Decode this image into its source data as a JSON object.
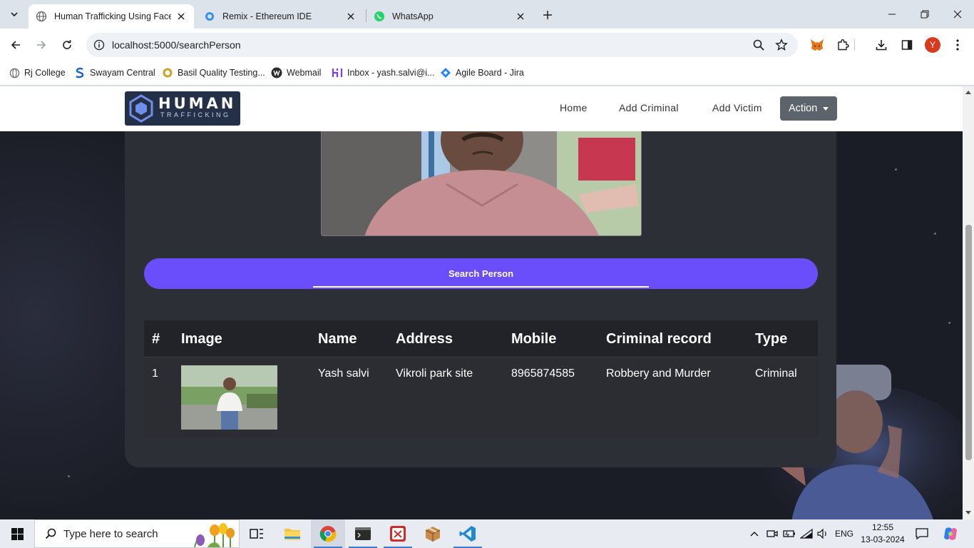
{
  "browser": {
    "tabs": [
      {
        "title": "Human Trafficking Using Face R",
        "active": true,
        "icon": "globe-icon"
      },
      {
        "title": "Remix - Ethereum IDE",
        "active": false,
        "icon": "remix-icon"
      },
      {
        "title": "WhatsApp",
        "active": false,
        "icon": "whatsapp-icon"
      }
    ],
    "url": "localhost:5000/searchPerson",
    "bookmarks": [
      {
        "label": "Rj College",
        "icon": "globe-icon"
      },
      {
        "label": "Swayam Central",
        "icon": "swayam-icon"
      },
      {
        "label": "Basil Quality Testing...",
        "icon": "basil-icon"
      },
      {
        "label": "Webmail",
        "icon": "webmail-icon"
      },
      {
        "label": "Inbox - yash.salvi@i...",
        "icon": "inbox-icon"
      },
      {
        "label": "Agile Board - Jira",
        "icon": "jira-icon"
      }
    ],
    "profile_initial": "Y"
  },
  "site": {
    "logo": {
      "main": "HUMAN",
      "sub": "TRAFFICKING"
    },
    "nav": {
      "home": "Home",
      "add_criminal": "Add Criminal",
      "add_victim": "Add Victim",
      "action": "Action"
    }
  },
  "search": {
    "button_label": "Search Person"
  },
  "results": {
    "headers": [
      "#",
      "Image",
      "Name",
      "Address",
      "Mobile",
      "Criminal record",
      "Type"
    ],
    "rows": [
      {
        "index": "1",
        "name": "Yash salvi",
        "address": "Vikroli park site",
        "mobile": "8965874585",
        "record": "Robbery and Murder",
        "type": "Criminal"
      }
    ]
  },
  "taskbar": {
    "search_placeholder": "Type here to search",
    "language": "ENG",
    "time": "12:55",
    "date": "13-03-2024"
  },
  "colors": {
    "accent": "#6a4dfb",
    "card": "#2d2f36",
    "header_bg": "#ffffff",
    "page_bg": "#1b1d26"
  }
}
